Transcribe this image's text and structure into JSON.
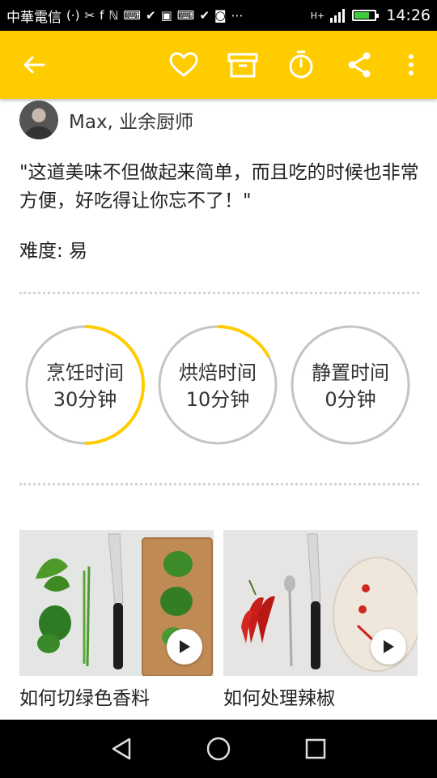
{
  "status_bar": {
    "carrier": "中華電信",
    "notification_icons": [
      "(⋅)",
      "✂",
      "f",
      "ℕ",
      "⌨",
      "✔",
      "▣",
      "⌨",
      "✔",
      "◙",
      "⋯"
    ],
    "network": "H+",
    "time": "14:26"
  },
  "toolbar": {
    "back_icon": "arrow-left",
    "favorite_icon": "heart",
    "archive_icon": "archive",
    "timer_icon": "stopwatch",
    "share_icon": "share",
    "more_icon": "vertical-dots",
    "accent": "#ffcc00"
  },
  "author": {
    "name": "Max, 业余厨师"
  },
  "quote": "\"这道美味不但做起来简单，而且吃的时候也非常方便，好吃得让你忘不了！\"",
  "difficulty": "难度: 易",
  "timers": [
    {
      "title": "烹饪时间",
      "value": "30分钟",
      "progress": 0.5
    },
    {
      "title": "烘焙时间",
      "value": "10分钟",
      "progress": 0.17
    },
    {
      "title": "静置时间",
      "value": "0分钟",
      "progress": 0
    }
  ],
  "videos": [
    {
      "title": "如何切绿色香料"
    },
    {
      "title": "如何处理辣椒"
    }
  ],
  "nav_bar": {
    "back_icon": "triangle-back",
    "home_icon": "circle-home",
    "recents_icon": "square-recents"
  }
}
